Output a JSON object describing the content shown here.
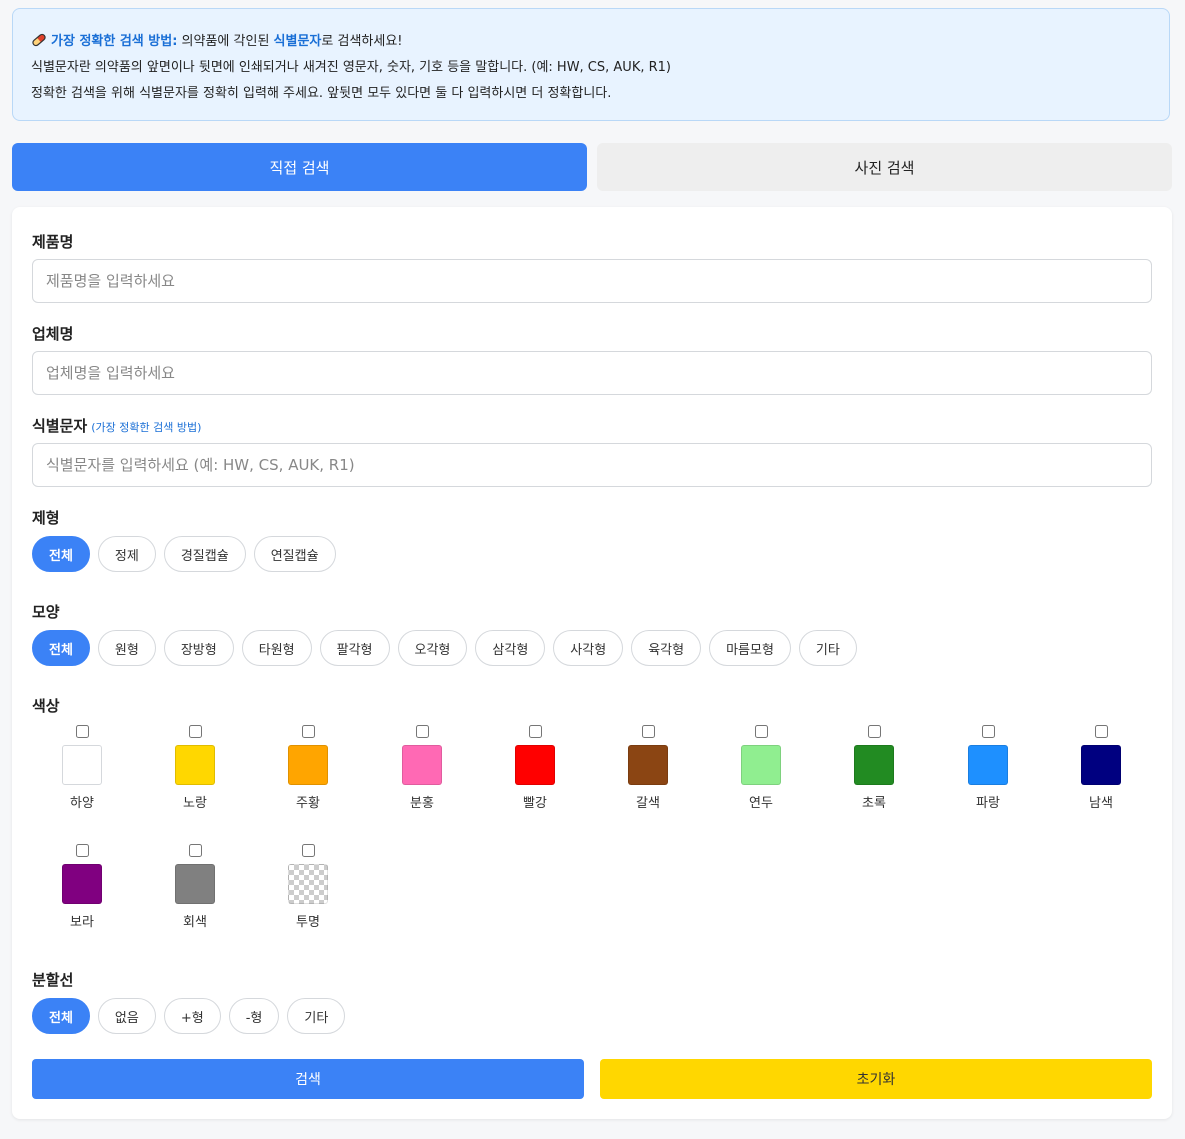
{
  "notice": {
    "line1_strong": "가장 정확한 검색 방법:",
    "line1_a": " 의약품에 각인된 ",
    "line1_highlight": "식별문자",
    "line1_b": "로 검색하세요!",
    "line2": "식별문자란 의약품의 앞면이나 뒷면에 인쇄되거나 새겨진 영문자, 숫자, 기호 등을 말합니다. (예: HW, CS, AUK, R1)",
    "line3": "정확한 검색을 위해 식별문자를 정확히 입력해 주세요. 앞뒷면 모두 있다면 둘 다 입력하시면 더 정확합니다."
  },
  "tabs": {
    "direct": "직접 검색",
    "photo": "사진 검색"
  },
  "form": {
    "product_label": "제품명",
    "product_placeholder": "제품명을 입력하세요",
    "company_label": "업체명",
    "company_placeholder": "업체명을 입력하세요",
    "mark_label": "식별문자",
    "mark_hint": "(가장 정확한 검색 방법)",
    "mark_placeholder": "식별문자를 입력하세요 (예: HW, CS, AUK, R1)",
    "form_label": "제형",
    "form_options": [
      "전체",
      "정제",
      "경질캡슐",
      "연질캡슐"
    ],
    "shape_label": "모양",
    "shape_options": [
      "전체",
      "원형",
      "장방형",
      "타원형",
      "팔각형",
      "오각형",
      "삼각형",
      "사각형",
      "육각형",
      "마름모형",
      "기타"
    ],
    "color_label": "색상",
    "colors": [
      {
        "name": "하양",
        "hex": "#ffffff"
      },
      {
        "name": "노랑",
        "hex": "#ffd700"
      },
      {
        "name": "주황",
        "hex": "#ffa500"
      },
      {
        "name": "분홍",
        "hex": "#ff69b4"
      },
      {
        "name": "빨강",
        "hex": "#ff0000"
      },
      {
        "name": "갈색",
        "hex": "#8b4513"
      },
      {
        "name": "연두",
        "hex": "#90ee90"
      },
      {
        "name": "초록",
        "hex": "#228b22"
      },
      {
        "name": "파랑",
        "hex": "#1e90ff"
      },
      {
        "name": "남색",
        "hex": "#000080"
      },
      {
        "name": "보라",
        "hex": "#800080"
      },
      {
        "name": "회색",
        "hex": "#808080"
      },
      {
        "name": "투명",
        "hex": "transparent"
      }
    ],
    "line_label": "분할선",
    "line_options": [
      "전체",
      "없음",
      "+형",
      "-형",
      "기타"
    ]
  },
  "buttons": {
    "search": "검색",
    "reset": "초기화"
  },
  "accent": "#3b82f6",
  "reset_color": "#ffd700"
}
